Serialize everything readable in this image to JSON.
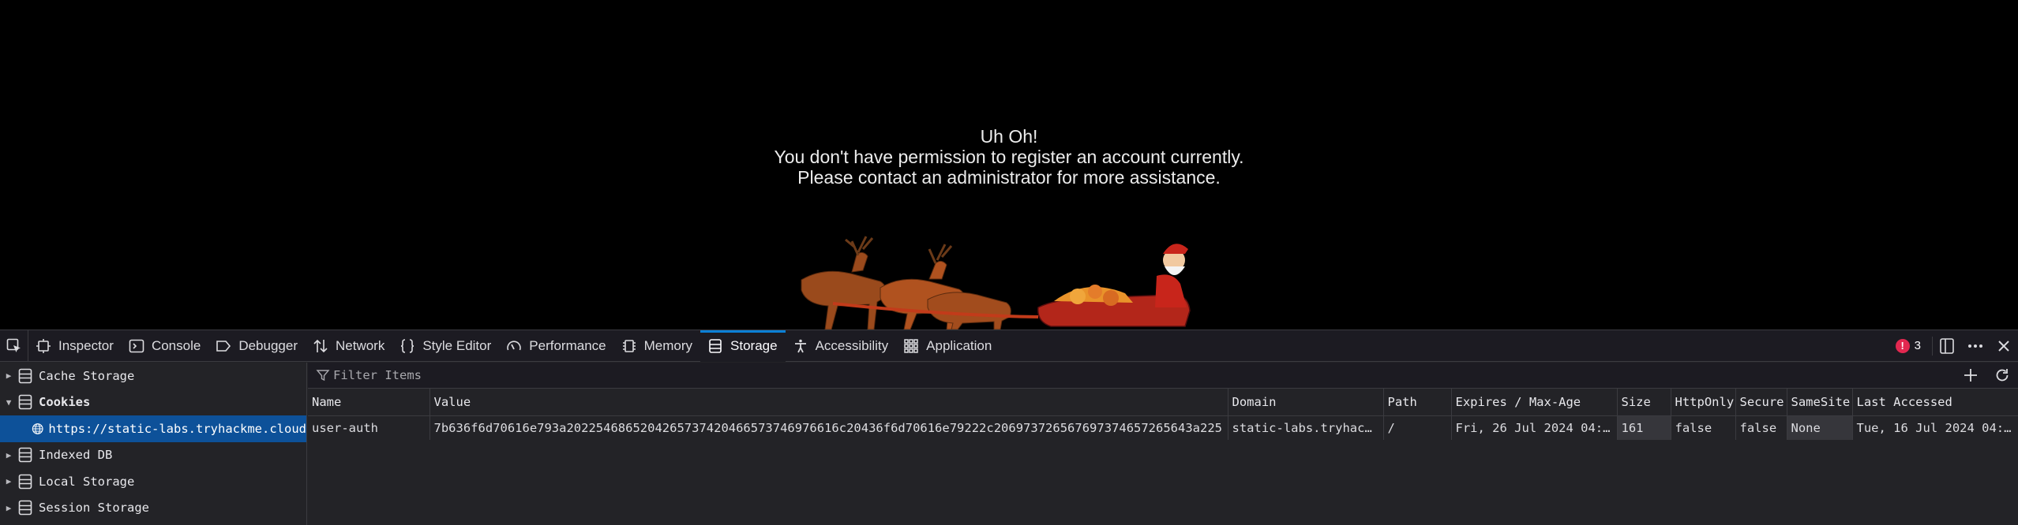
{
  "page": {
    "message_lines": [
      "Uh Oh!",
      "You don't have permission to register an account currently.",
      "Please contact an administrator for more assistance."
    ]
  },
  "devtools": {
    "tabs": [
      {
        "label": "Inspector",
        "icon": "inspector-icon"
      },
      {
        "label": "Console",
        "icon": "console-icon"
      },
      {
        "label": "Debugger",
        "icon": "debugger-icon"
      },
      {
        "label": "Network",
        "icon": "network-icon"
      },
      {
        "label": "Style Editor",
        "icon": "style-editor-icon"
      },
      {
        "label": "Performance",
        "icon": "performance-icon"
      },
      {
        "label": "Memory",
        "icon": "memory-icon"
      },
      {
        "label": "Storage",
        "icon": "storage-icon"
      },
      {
        "label": "Accessibility",
        "icon": "accessibility-icon"
      },
      {
        "label": "Application",
        "icon": "application-icon"
      }
    ],
    "active_tab": "Storage",
    "error_count": "3",
    "accent_color": "#0b80d6",
    "sidebar": {
      "cache_storage": "Cache Storage",
      "cookies": "Cookies",
      "cookie_host": "https://static-labs.tryhackme.cloud",
      "indexed_db": "Indexed DB",
      "local_storage": "Local Storage",
      "session_storage": "Session Storage"
    },
    "filter_placeholder": "Filter Items",
    "columns": [
      "Name",
      "Value",
      "Domain",
      "Path",
      "Expires / Max-Age",
      "Size",
      "HttpOnly",
      "Secure",
      "SameSite",
      "Last Accessed"
    ],
    "rows": [
      {
        "name": "user-auth",
        "value": "7b636f6d70616e793a2022546865204265737420466573746976616c20436f6d70616e79222c206973726567697374657265643a225",
        "domain": "static-labs.tryhack…",
        "path": "/",
        "expires": "Fri, 26 Jul 2024 04:…",
        "size": "161",
        "httponly": "false",
        "secure": "false",
        "samesite": "None",
        "last_accessed": "Tue, 16 Jul 2024 04:…"
      }
    ]
  }
}
